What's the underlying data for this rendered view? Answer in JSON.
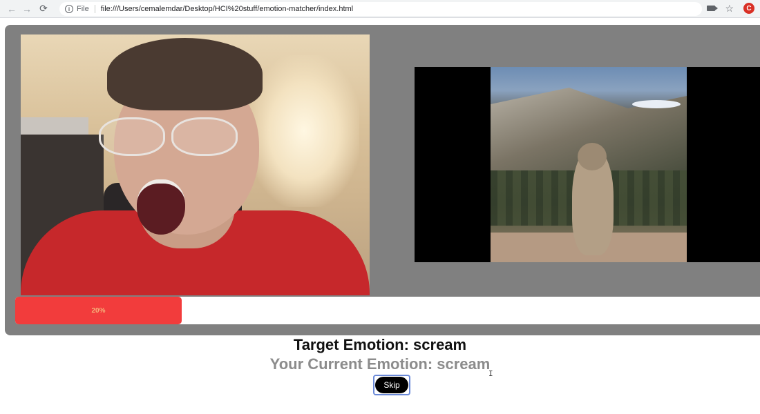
{
  "browser": {
    "scheme": "File",
    "url": "file:///Users/cemalemdar/Desktop/HCI%20stuff/emotion-matcher/index.html",
    "profile_initial": "C",
    "icons": [
      "back-arrow-icon",
      "forward-arrow-icon",
      "reload-icon",
      "info-icon",
      "camera-icon",
      "star-icon"
    ]
  },
  "progress": {
    "label": "20%",
    "value": 0.2,
    "color": "#f23c3c"
  },
  "emotion": {
    "target_label": "Target Emotion: scream",
    "current_label": "Your Current Emotion: scream"
  },
  "controls": {
    "skip_label": "Skip"
  },
  "colors": {
    "panel": "#808080",
    "progress_fill": "#f23c3c"
  }
}
